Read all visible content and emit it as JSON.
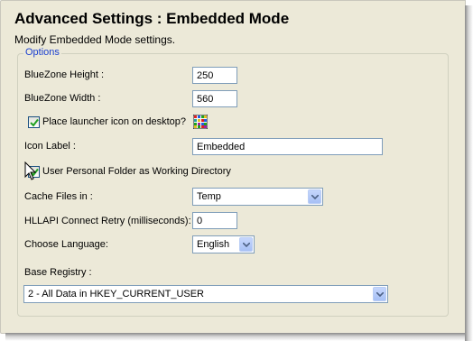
{
  "header": {
    "title": "Advanced Settings : Embedded Mode",
    "subtitle": "Modify Embedded Mode settings."
  },
  "options": {
    "legend": "Options",
    "bluezone_height": {
      "label": "BlueZone Height :",
      "value": "250"
    },
    "bluezone_width": {
      "label": "BlueZone Width :",
      "value": "560"
    },
    "launcher_icon": {
      "label": "Place launcher icon on desktop?",
      "checked": true
    },
    "icon_label": {
      "label": "Icon Label :",
      "value": "Embedded"
    },
    "personal_folder": {
      "label": "User Personal Folder as Working Directory",
      "checked": true
    },
    "cache_files": {
      "label": "Cache Files in :",
      "selected": "Temp"
    },
    "hllapi_retry": {
      "label": "HLLAPI Connect Retry (milliseconds):",
      "value": "0"
    },
    "language": {
      "label": "Choose Language:",
      "selected": "English"
    },
    "base_registry": {
      "label": "Base Registry :",
      "selected": "2 - All Data in HKEY_CURRENT_USER"
    }
  },
  "colors": {
    "legend": "#1a3fd0",
    "panel": "#ece9d8",
    "border": "#7f9db9",
    "check": "#21a121"
  },
  "icons": [
    "checkmark-icon",
    "launcher-icon",
    "dropdown-arrow-icon",
    "mouse-cursor-icon"
  ]
}
